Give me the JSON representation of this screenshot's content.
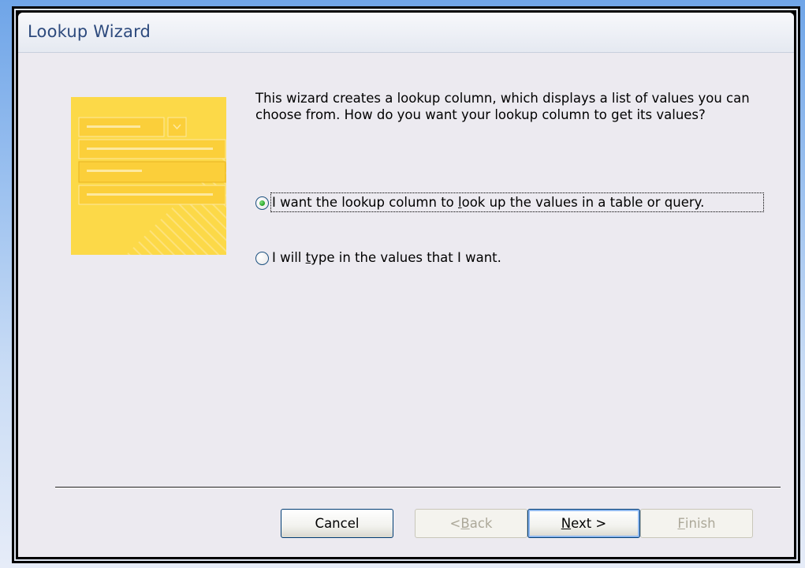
{
  "window": {
    "title": "Lookup Wizard"
  },
  "intro_text": "This wizard creates a lookup column, which displays a list of values you can choose from.  How do you want your lookup column to get its values?",
  "options": [
    {
      "label_before": "I want the lookup column to ",
      "accel": "l",
      "label_after": "ook up the values in a table or query.",
      "selected": true
    },
    {
      "label_before": "I will ",
      "accel": "t",
      "label_after": "ype in the values that I want.",
      "selected": false
    }
  ],
  "buttons": {
    "cancel": {
      "label": "Cancel",
      "enabled": true
    },
    "back": {
      "prefix": "< ",
      "accel": "B",
      "rest": "ack",
      "enabled": false
    },
    "next": {
      "accel": "N",
      "rest": "ext >",
      "enabled": true
    },
    "finish": {
      "accel": "F",
      "rest": "inish",
      "enabled": false
    }
  },
  "illustration": {
    "icon": "lookup-list-illustration",
    "colors": {
      "base": "#fcd948",
      "row": "#fbcf3a",
      "line": "#fde9a0",
      "border": "#e8b321"
    }
  }
}
